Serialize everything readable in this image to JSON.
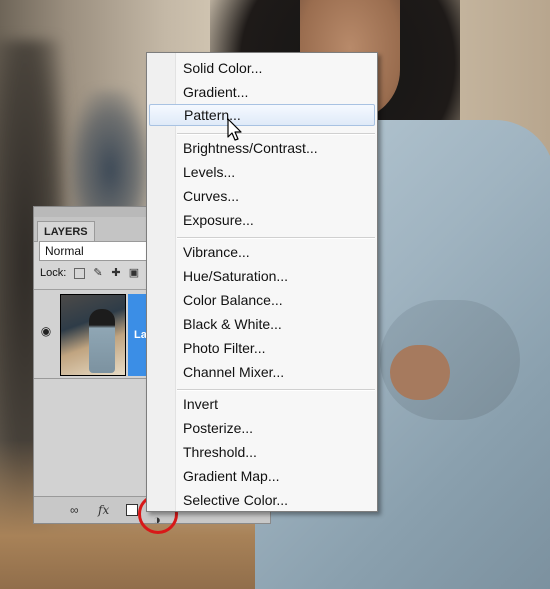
{
  "panel": {
    "tab_label": "LAYERS",
    "blend_mode": "Normal",
    "lock_label": "Lock:",
    "layer_name": "La",
    "bottom_icons": {
      "link": "link-icon",
      "fx": "fx",
      "mask": "mask-icon",
      "adjustment": "adjustment-layer-icon"
    }
  },
  "menu": {
    "group1": [
      "Solid Color...",
      "Gradient...",
      "Pattern..."
    ],
    "group2": [
      "Brightness/Contrast...",
      "Levels...",
      "Curves...",
      "Exposure..."
    ],
    "group3": [
      "Vibrance...",
      "Hue/Saturation...",
      "Color Balance...",
      "Black & White...",
      "Photo Filter...",
      "Channel Mixer..."
    ],
    "group4": [
      "Invert",
      "Posterize...",
      "Threshold...",
      "Gradient Map...",
      "Selective Color..."
    ],
    "highlighted": "Pattern..."
  },
  "colors": {
    "selection": "#3b8ee6",
    "annotation": "#d81818"
  }
}
